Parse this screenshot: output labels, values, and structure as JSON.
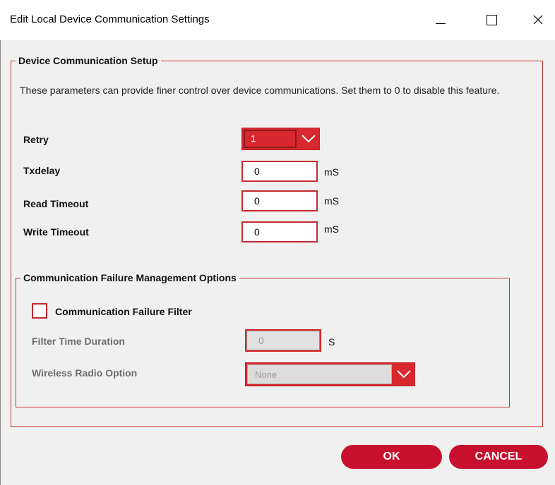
{
  "window": {
    "title": "Edit Local Device Communication Settings"
  },
  "setup": {
    "legend": "Device Communication Setup",
    "description": "These parameters can provide finer control over device communications. Set them to 0 to disable this feature.",
    "retry": {
      "label": "Retry",
      "value": "1"
    },
    "txdelay": {
      "label": "Txdelay",
      "value": "0",
      "unit": "mS"
    },
    "read_timeout": {
      "label": "Read Timeout",
      "value": "0",
      "unit": "mS"
    },
    "write_timeout": {
      "label": "Write Timeout",
      "value": "0",
      "unit": "mS"
    }
  },
  "failure": {
    "legend": "Communication Failure Management Options",
    "filter_checkbox_label": "Communication Failure Filter",
    "filter_checked": false,
    "filter_time": {
      "label": "Filter Time Duration",
      "value": "0",
      "unit": "S"
    },
    "radio_option": {
      "label": "Wireless Radio Option",
      "value": "None"
    }
  },
  "buttons": {
    "ok": "OK",
    "cancel": "CANCEL"
  },
  "colors": {
    "accent": "#c8102e",
    "border": "#c9302c"
  }
}
